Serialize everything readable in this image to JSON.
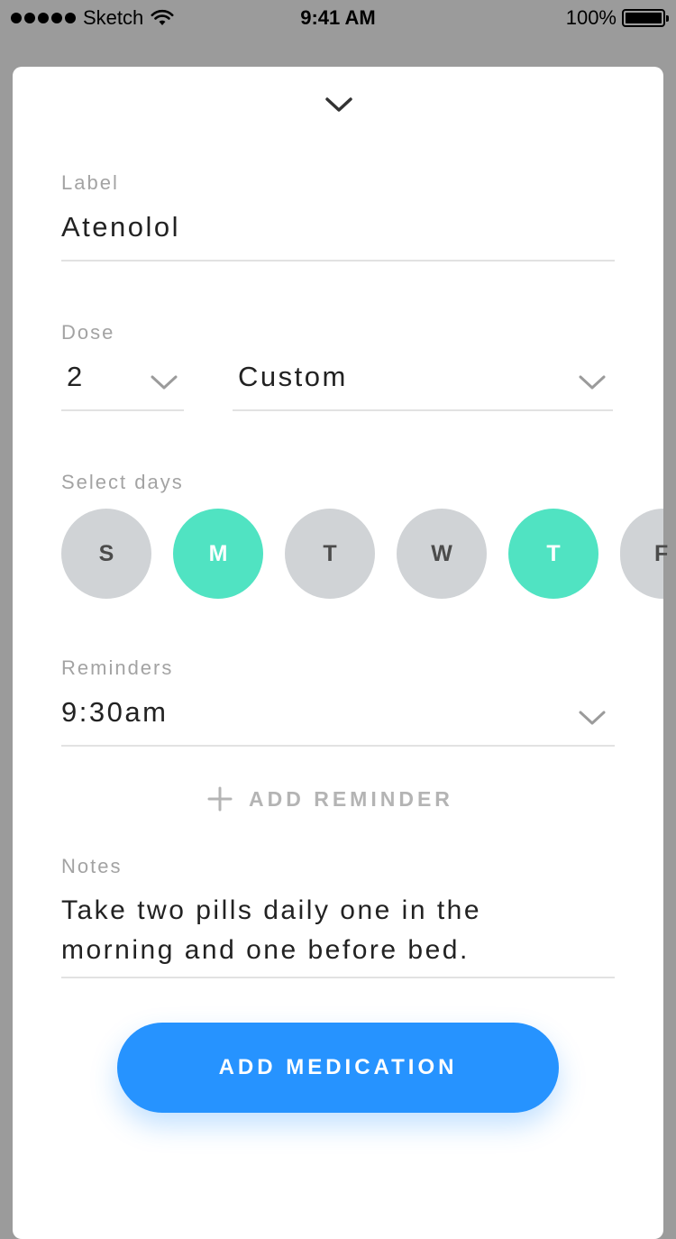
{
  "status_bar": {
    "carrier": "Sketch",
    "time": "9:41 AM",
    "battery": "100%"
  },
  "form": {
    "label": {
      "title": "Label",
      "value": "Atenolol"
    },
    "dose": {
      "title": "Dose",
      "amount": "2",
      "unit": "Custom"
    },
    "days": {
      "title": "Select days",
      "items": [
        {
          "letter": "S",
          "selected": false
        },
        {
          "letter": "M",
          "selected": true
        },
        {
          "letter": "T",
          "selected": false
        },
        {
          "letter": "W",
          "selected": false
        },
        {
          "letter": "T",
          "selected": true
        },
        {
          "letter": "F",
          "selected": false
        }
      ]
    },
    "reminders": {
      "title": "Reminders",
      "value": "9:30am"
    },
    "add_reminder_label": "ADD REMINDER",
    "notes": {
      "title": "Notes",
      "value": "Take two pills daily one in the morning and one before bed."
    },
    "submit_label": "ADD MEDICATION"
  },
  "colors": {
    "accent": "#2693ff",
    "day_selected": "#50e3c2",
    "day_unselected": "#d0d3d6"
  },
  "icons": [
    "signal-dots-icon",
    "wifi-icon",
    "battery-icon",
    "chevron-down-icon",
    "plus-icon"
  ]
}
